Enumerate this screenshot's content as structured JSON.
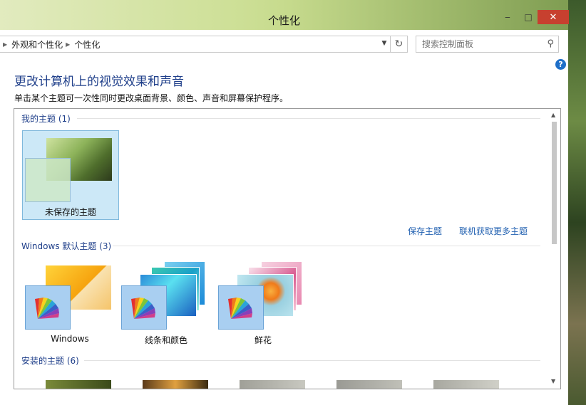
{
  "window": {
    "title": "个性化",
    "min_label": "‒",
    "max_label": "□",
    "close_label": "✕"
  },
  "address": {
    "crumbs": [
      "外观和个性化",
      "个性化"
    ],
    "search_placeholder": "搜索控制面板"
  },
  "page": {
    "heading": "更改计算机上的视觉效果和声音",
    "subtext": "单击某个主题可一次性同时更改桌面背景、颜色、声音和屏幕保护程序。"
  },
  "sections": {
    "my_themes": {
      "label": "我的主题 (1)",
      "items": [
        {
          "label": "未保存的主题"
        }
      ],
      "save_link": "保存主题",
      "online_link": "联机获取更多主题"
    },
    "default_themes": {
      "label": "Windows 默认主题 (3)",
      "items": [
        {
          "label": "Windows"
        },
        {
          "label": "线条和颜色"
        },
        {
          "label": "鲜花"
        }
      ]
    },
    "installed_themes": {
      "label": "安装的主题 (6)"
    }
  },
  "icons": {
    "help": "help-icon",
    "search": "search-icon",
    "refresh": "refresh-icon"
  },
  "colors": {
    "accent": "#1f3f8a",
    "link": "#1f5fb0",
    "selected_bg": "#cce8f7",
    "close": "#c7402f"
  }
}
